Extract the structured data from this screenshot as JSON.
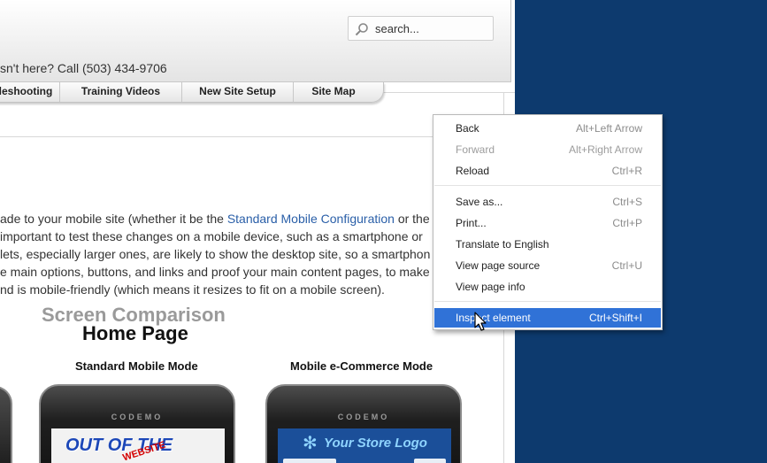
{
  "header": {
    "search_placeholder": "search...",
    "phone_text": "sn't here? Call (503) 434-9706"
  },
  "nav": {
    "items": [
      {
        "label": "leshooting"
      },
      {
        "label": "Training Videos"
      },
      {
        "label": "New Site Setup"
      },
      {
        "label": "Site Map"
      }
    ]
  },
  "article": {
    "line1_pre": "ade to your mobile site (whether it be the ",
    "line1_link": "Standard Mobile Configuration",
    "line1_post": " or the",
    "line2": "important to test these changes on a mobile device, such as a smartphone or",
    "line3": "lets, especially larger ones, are likely to show the desktop site, so a smartphon",
    "line4": "e main options, buttons, and links and proof your main content pages, to make",
    "line5": "nd is mobile-friendly (which means it resizes to fit on a mobile screen)."
  },
  "comparison": {
    "title": "Screen Comparison",
    "subtitle": "Home Page",
    "standard_label": "Standard Mobile Mode",
    "ecommerce_label": "Mobile e-Commerce Mode",
    "phone_brand": "CODEMO",
    "standard_screen_text": "OUT OF THE",
    "standard_screen_stamp": "WEBSITE",
    "ecommerce_screen_text": "Your Store Logo"
  },
  "context_menu": {
    "items": [
      {
        "label": "Back",
        "shortcut": "Alt+Left Arrow",
        "disabled": false
      },
      {
        "label": "Forward",
        "shortcut": "Alt+Right Arrow",
        "disabled": true
      },
      {
        "label": "Reload",
        "shortcut": "Ctrl+R",
        "disabled": false
      },
      {
        "label": "Save as...",
        "shortcut": "Ctrl+S",
        "disabled": false
      },
      {
        "label": "Print...",
        "shortcut": "Ctrl+P",
        "disabled": false
      },
      {
        "label": "Translate to English",
        "shortcut": "",
        "disabled": false
      },
      {
        "label": "View page source",
        "shortcut": "Ctrl+U",
        "disabled": false
      },
      {
        "label": "View page info",
        "shortcut": "",
        "disabled": false
      },
      {
        "label": "Inspect element",
        "shortcut": "Ctrl+Shift+I",
        "disabled": false,
        "highlighted": true
      }
    ]
  },
  "colors": {
    "desktop_background": "#0d3a6e",
    "menu_highlight": "#3072d7",
    "link": "#2a5fa8"
  }
}
